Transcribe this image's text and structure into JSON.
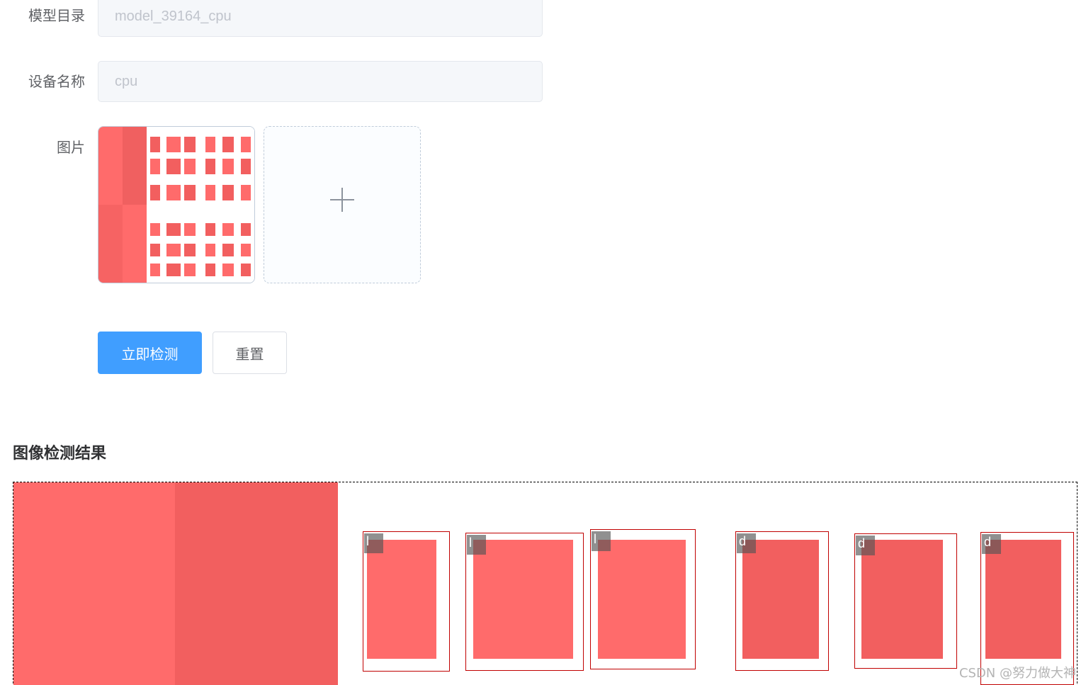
{
  "form": {
    "model_dir_label": "模型目录",
    "model_dir_value": "model_39164_cpu",
    "device_label": "设备名称",
    "device_value": "cpu",
    "image_label": "图片"
  },
  "buttons": {
    "detect_label": "立即检测",
    "reset_label": "重置"
  },
  "results": {
    "title": "图像检测结果",
    "detections": [
      {
        "label": "l"
      },
      {
        "label": "l"
      },
      {
        "label": "l"
      },
      {
        "label": "d"
      },
      {
        "label": "d"
      },
      {
        "label": "d"
      }
    ]
  },
  "watermark": "CSDN @努力做大神",
  "colors": {
    "primary": "#409eff",
    "bbox": "#c00000",
    "panel_light": "#ff6b6b",
    "panel_dark": "#f25f5f"
  },
  "icons": {
    "upload": "plus-icon"
  }
}
